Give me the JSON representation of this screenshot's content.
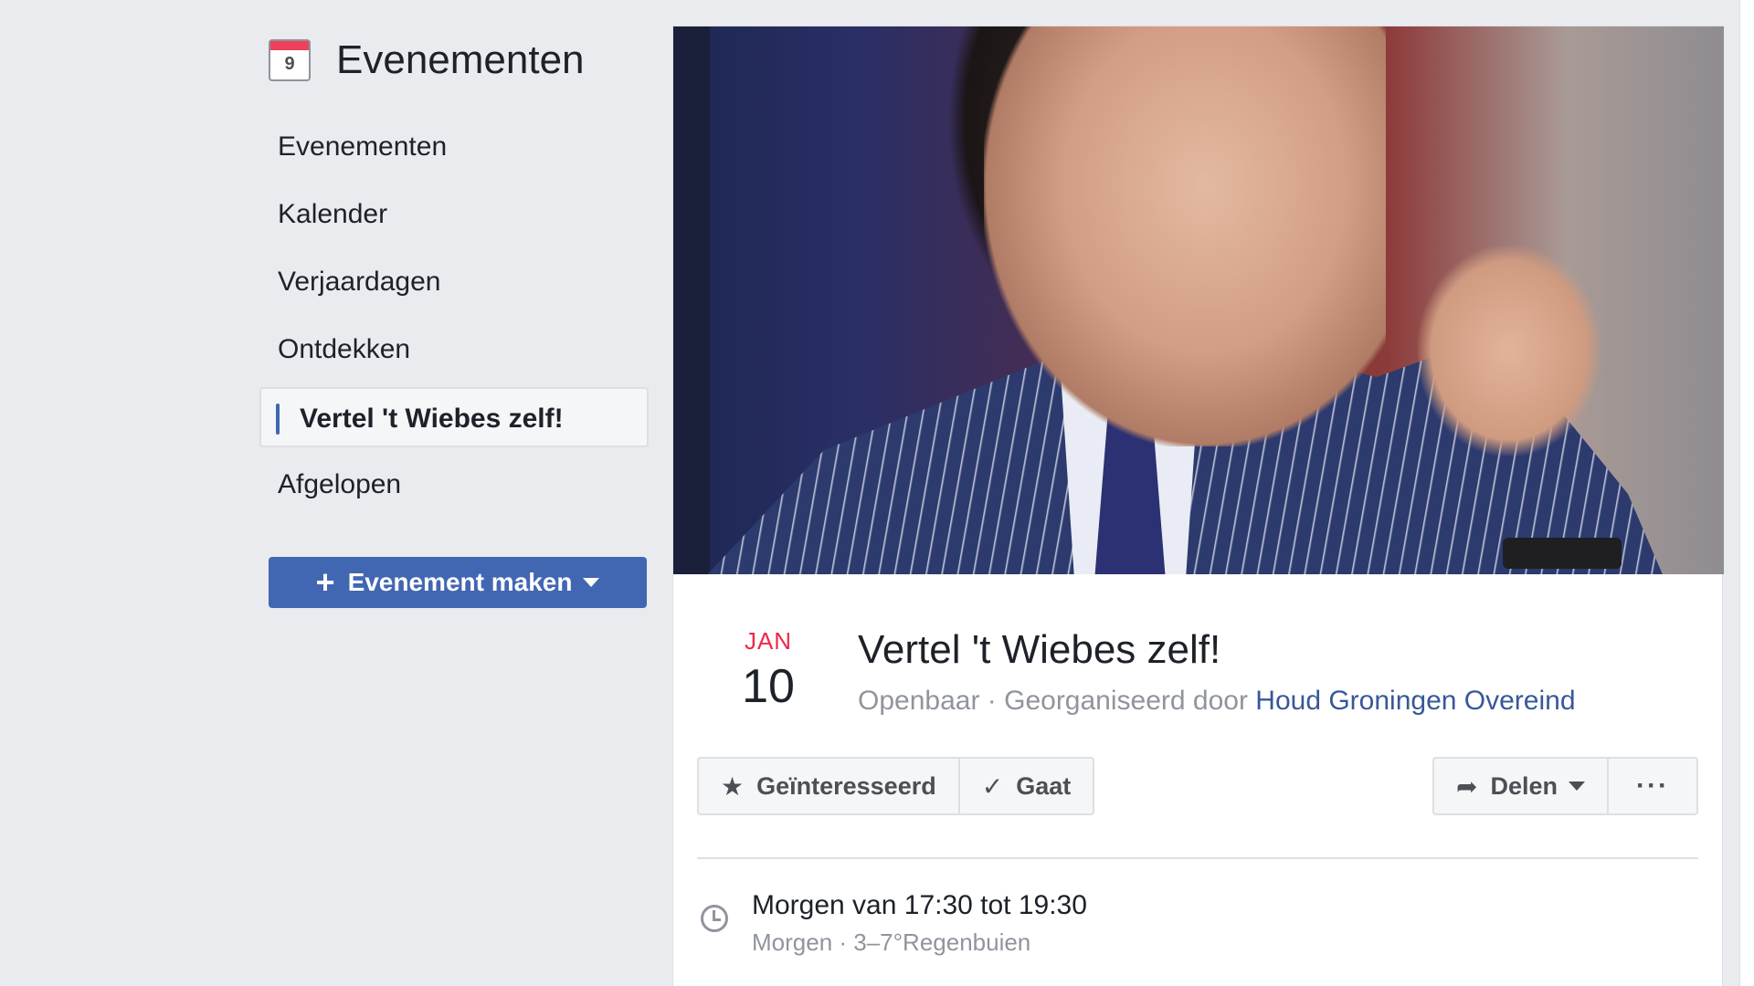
{
  "sidebar": {
    "calendar_icon_day": "9",
    "title": "Evenementen",
    "items": [
      {
        "label": "Evenementen"
      },
      {
        "label": "Kalender"
      },
      {
        "label": "Verjaardagen"
      },
      {
        "label": "Ontdekken"
      },
      {
        "label": "Vertel 't Wiebes zelf!",
        "active": true
      },
      {
        "label": "Afgelopen"
      }
    ],
    "create_button": {
      "plus": "+",
      "label": "Evenement maken"
    }
  },
  "event": {
    "month": "JAN",
    "day": "10",
    "title": "Vertel 't Wiebes zelf!",
    "privacy": "Openbaar",
    "separator": " · ",
    "organized_by": "Georganiseerd door",
    "organizer": "Houd Groningen Overeind",
    "actions": {
      "interested": {
        "icon": "★",
        "label": "Geïnteresseerd"
      },
      "going": {
        "icon": "✓",
        "label": "Gaat"
      },
      "share": {
        "icon": "➦",
        "label": "Delen"
      },
      "more": "···"
    },
    "when": {
      "main": "Morgen van 17:30 tot 19:30",
      "sub": "Morgen · 3–7°Regenbuien"
    }
  },
  "colors": {
    "accent": "#4267b2",
    "date_month": "#f02849",
    "link": "#385898"
  }
}
